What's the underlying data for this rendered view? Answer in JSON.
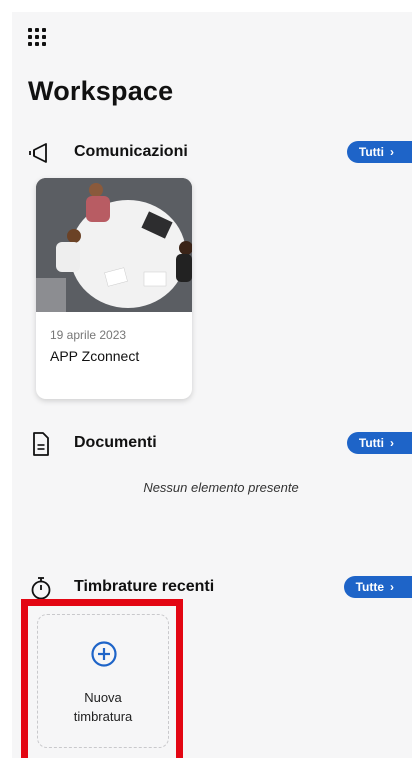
{
  "header": {
    "menu_icon": "apps-grid-icon",
    "title": "Workspace"
  },
  "communications": {
    "title": "Comunicazioni",
    "icon": "megaphone-icon",
    "all_label": "Tutti",
    "items": [
      {
        "date": "19 aprile 2023",
        "title": "APP Zconnect",
        "image": "meeting-photo"
      }
    ]
  },
  "documents": {
    "title": "Documenti",
    "icon": "document-icon",
    "all_label": "Tutti",
    "empty_text": "Nessun elemento presente"
  },
  "punches": {
    "title": "Timbrature recenti",
    "icon": "stopwatch-icon",
    "all_label": "Tutte",
    "new_label_line1": "Nuova",
    "new_label_line2": "timbratura",
    "new_icon": "plus-circle-icon"
  },
  "colors": {
    "accent": "#1e64c8",
    "highlight": "#e30613",
    "background": "#f6f6f7"
  }
}
